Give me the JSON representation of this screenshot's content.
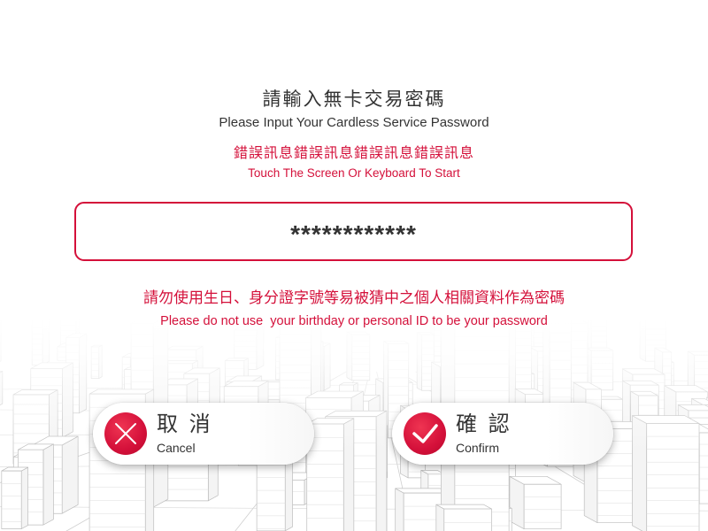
{
  "header": {
    "title_zh": "請輸入無卡交易密碼",
    "title_en": "Please Input Your Cardless Service Password"
  },
  "message": {
    "error_zh": "錯誤訊息錯誤訊息錯誤訊息錯誤訊息",
    "prompt_en": "Touch The Screen Or Keyboard To Start"
  },
  "password_field": {
    "value": "************"
  },
  "warning": {
    "zh": "請勿使用生日、身分證字號等易被猜中之個人相關資料作為密碼",
    "en": "Please do not use  your birthday or personal ID to be your password"
  },
  "buttons": {
    "cancel": {
      "label_zh": "取 消",
      "label_en": "Cancel",
      "icon": "close-icon"
    },
    "confirm": {
      "label_zh": "確 認",
      "label_en": "Confirm",
      "icon": "check-icon"
    }
  },
  "colors": {
    "accent": "#d4103a",
    "text": "#333333"
  }
}
